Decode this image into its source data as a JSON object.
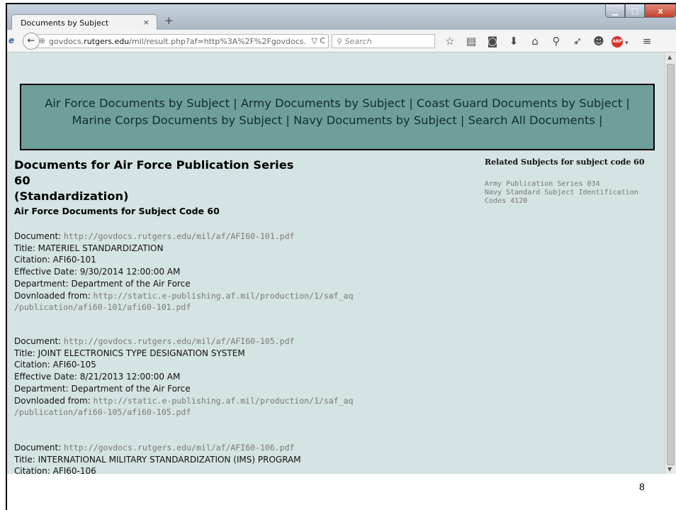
{
  "browser": {
    "tab_title": "Documents by Subject",
    "tab_close": "×",
    "new_tab": "+",
    "url_prefix": "govdocs.",
    "url_host": "rutgers.edu",
    "url_rest": "/mil/result.php?af=http%3A%2F%2Fgovdocs.",
    "url_controls": "▽ C",
    "search_placeholder": "Search",
    "window_controls": {
      "minimize": "▁",
      "maximize": "□",
      "close": "x"
    }
  },
  "nav": {
    "links": [
      "Air Force Documents by Subject |",
      "Army Documents by Subject |",
      "Coast Guard Documents by Subject |",
      "Marine Corps Documents by Subject |",
      "Navy Documents by Subject |",
      "Search All Documents |"
    ]
  },
  "page": {
    "heading_line1": "Documents for Air Force Publication Series 60",
    "heading_line2": "(Standardization)",
    "subheading": "Air Force Documents for Subject Code 60"
  },
  "related": {
    "title": "Related Subjects for subject code 60",
    "items": [
      "Army Publication Series 034",
      "Navy Standard Subject Identification",
      "Codes 4120"
    ]
  },
  "labels": {
    "document": "Document:",
    "title": "Title:",
    "citation": "Citation:",
    "effective": "Effective Date:",
    "department": "Department:",
    "downloaded": "Dovnloaded from:"
  },
  "documents": [
    {
      "url": "http://govdocs.rutgers.edu/mil/af/AFI60-101.pdf",
      "title": "MATERIEL STANDARDIZATION",
      "citation": "AFI60-101",
      "effective": "9/30/2014 12:00:00 AM",
      "department": "Department of the Air Force",
      "source_line1": "http://static.e-publishing.af.mil/production/1/saf_aq",
      "source_line2": "/publication/afi60-101/afi60-101.pdf"
    },
    {
      "url": "http://govdocs.rutgers.edu/mil/af/AFI60-105.pdf",
      "title": "JOINT ELECTRONICS TYPE DESIGNATION SYSTEM",
      "citation": "AFI60-105",
      "effective": "8/21/2013 12:00:00 AM",
      "department": "Department of the Air Force",
      "source_line1": "http://static.e-publishing.af.mil/production/1/saf_aq",
      "source_line2": "/publication/afi60-105/afi60-105.pdf"
    },
    {
      "url": "http://govdocs.rutgers.edu/mil/af/AFI60-106.pdf",
      "title": "INTERNATIONAL MILITARY STANDARDIZATION (IMS) PROGRAM",
      "citation": "AFI60-106"
    }
  ],
  "slide": {
    "page_number": "8"
  }
}
